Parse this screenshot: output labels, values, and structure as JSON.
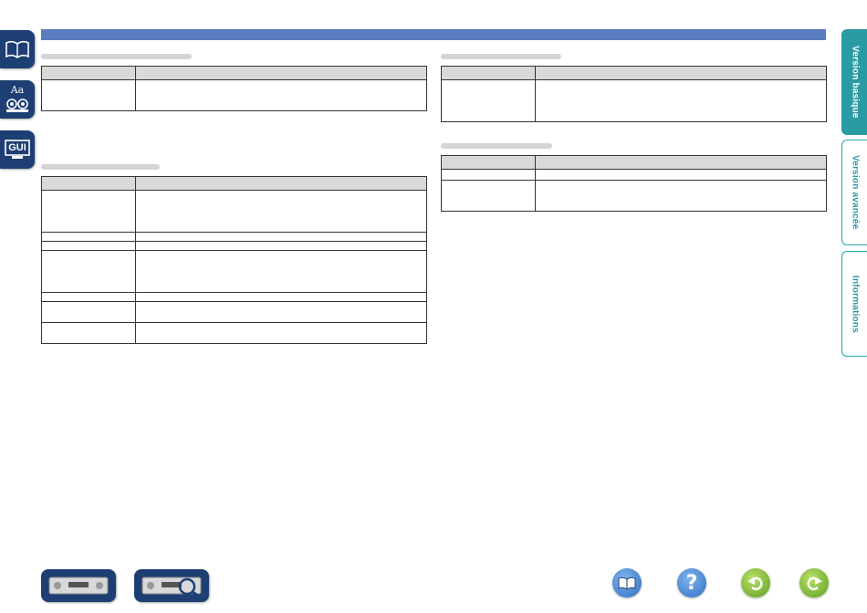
{
  "left_tabs": [
    {
      "icon": "book-icon"
    },
    {
      "icon": "speakers-icon",
      "text": "Aa"
    },
    {
      "icon": "gui-icon",
      "text": "GUI"
    }
  ],
  "right_tabs": [
    {
      "label": "Version basique",
      "active": true
    },
    {
      "label": "Version avancée",
      "active": false
    },
    {
      "label": "Informations",
      "active": false
    }
  ],
  "link_text": "",
  "bottom_nav": [
    {
      "icon": "receiver-front-icon"
    },
    {
      "icon": "receiver-rear-icon"
    },
    {
      "icon": "contents-book-icon"
    },
    {
      "icon": "help-icon",
      "text": "?"
    },
    {
      "icon": "back-icon"
    },
    {
      "icon": "forward-icon"
    }
  ],
  "colors": {
    "header_bar": "#5a7dc0",
    "left_tab": "#1d3f73",
    "right_tab_accent": "#2a9aa3"
  }
}
